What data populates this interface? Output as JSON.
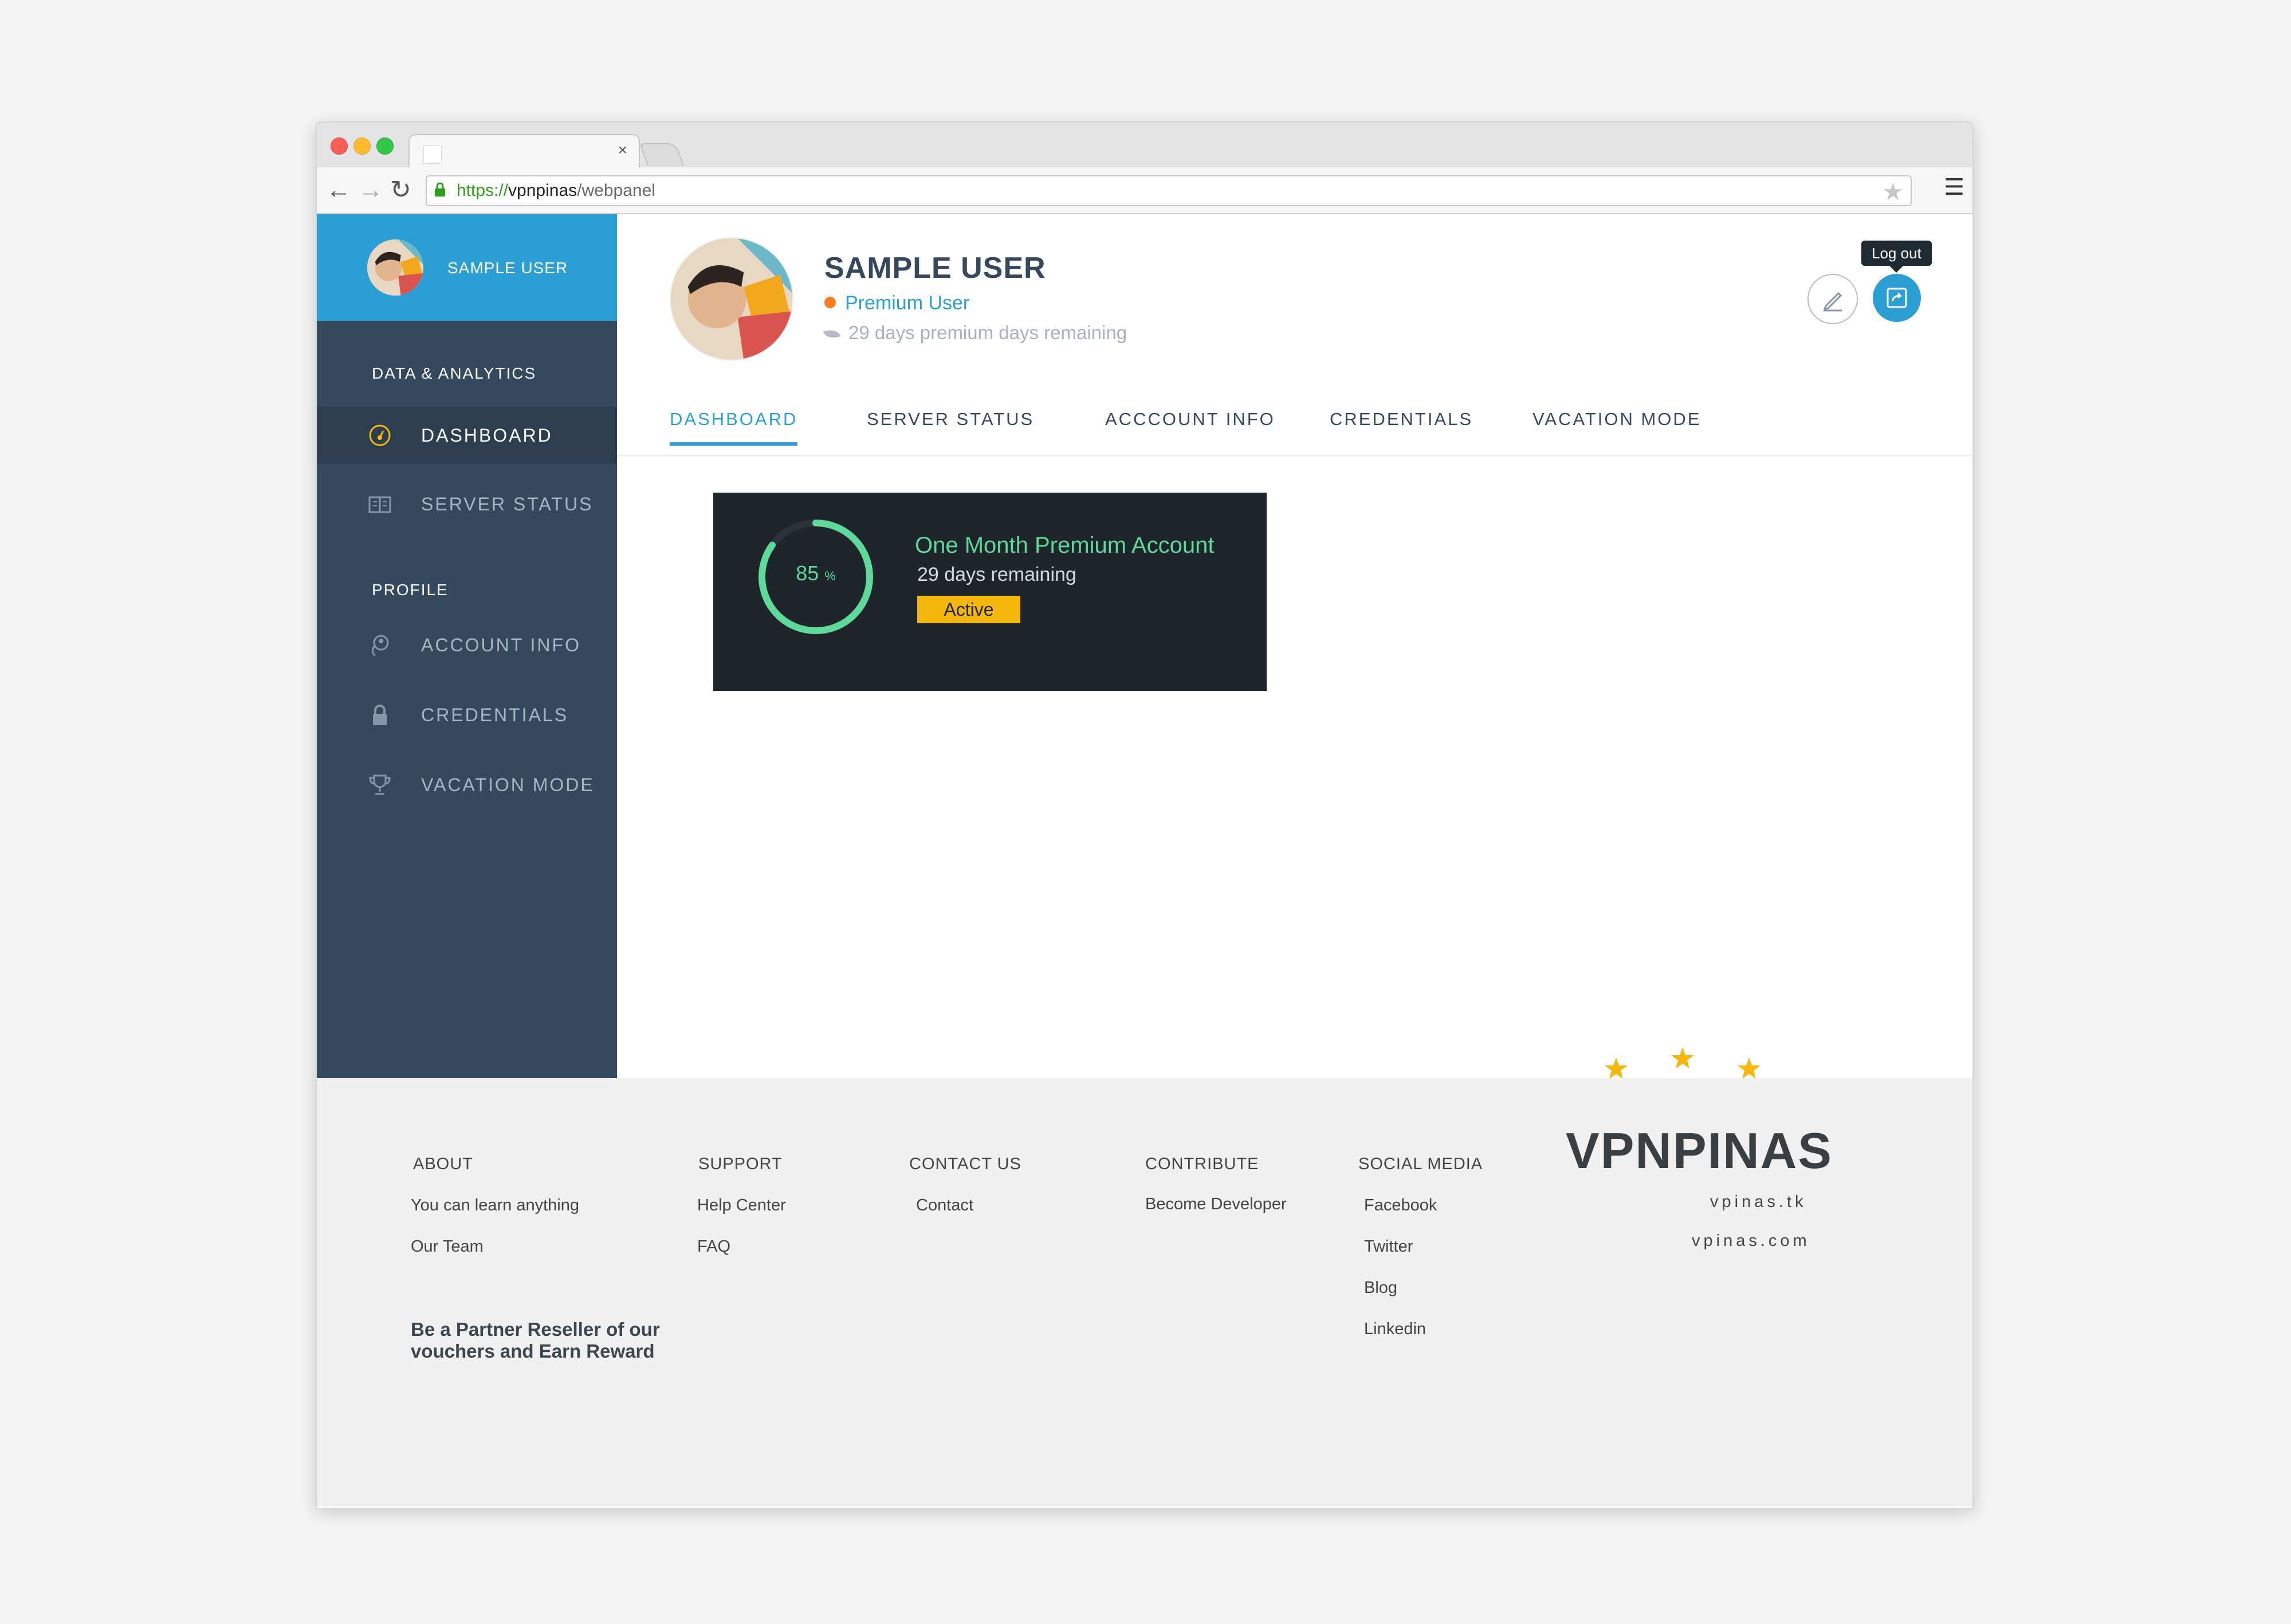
{
  "browser": {
    "url_scheme": "https://",
    "url_host": "vpnpinas",
    "url_path": "/webpanel",
    "tab_close": "×"
  },
  "sidebar": {
    "username": "SAMPLE USER",
    "section_data": "DATA & ANALYTICS",
    "section_profile": "PROFILE",
    "items": [
      {
        "label": "DASHBOARD",
        "icon": "speedometer-icon",
        "active": true
      },
      {
        "label": "SERVER STATUS",
        "icon": "book-icon"
      },
      {
        "label": "ACCOUNT INFO",
        "icon": "user-location-icon"
      },
      {
        "label": "CREDENTIALS",
        "icon": "lock-icon"
      },
      {
        "label": "VACATION MODE",
        "icon": "trophy-icon"
      }
    ]
  },
  "profile": {
    "name": "SAMPLE USER",
    "status": "Premium User",
    "days_remaining": "29 days premium days remaining",
    "logout_tooltip": "Log out"
  },
  "tabs": [
    "DASHBOARD",
    "SERVER STATUS",
    "ACCCOUNT INFO",
    "CREDENTIALS",
    "VACATION MODE"
  ],
  "card": {
    "percent": "85",
    "percent_unit": "%",
    "progress": 0.85,
    "title": "One Month Premium Account",
    "subtitle": "29 days remaining",
    "badge": "Active"
  },
  "footer": {
    "about": {
      "heading": "ABOUT",
      "links": [
        "You can learn anything",
        "Our Team"
      ]
    },
    "support": {
      "heading": "SUPPORT",
      "links": [
        "Help Center",
        "FAQ"
      ]
    },
    "contact": {
      "heading": "CONTACT US",
      "links": [
        "Contact"
      ]
    },
    "contribute": {
      "heading": "CONTRIBUTE",
      "links": [
        "Become Developer"
      ]
    },
    "social": {
      "heading": "SOCIAL MEDIA",
      "links": [
        "Facebook",
        "Twitter",
        "Blog",
        "Linkedin"
      ]
    },
    "partner": "Be a Partner Reseller of our vouchers and Earn Reward",
    "brand": "VPNPINAS",
    "domains": [
      "vpinas.tk",
      "vpinas.com"
    ]
  },
  "colors": {
    "accent": "#2b9fd3",
    "sidebar": "#34495e",
    "card": "#1e252b",
    "ring": "#5fd89a",
    "badge": "#f5b60d"
  }
}
